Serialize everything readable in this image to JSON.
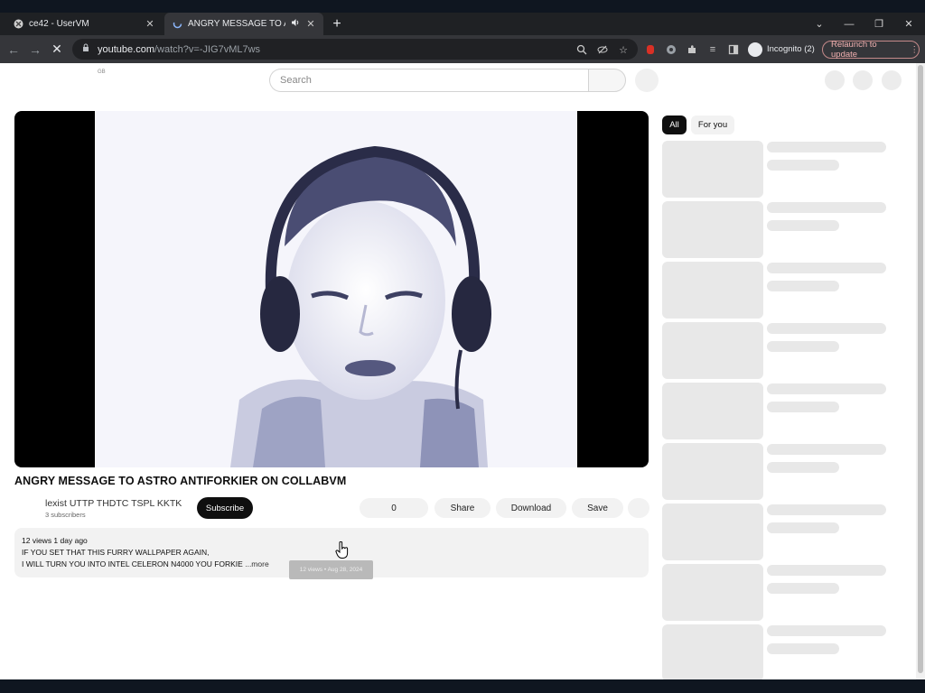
{
  "browser": {
    "tabs": [
      {
        "label": "ce42 - UserVM",
        "close": "✕"
      },
      {
        "label": "ANGRY MESSAGE TO ASTRO",
        "close": "✕"
      }
    ],
    "new_tab": "+",
    "url_host": "youtube.com",
    "url_path": "/watch?v=-JIG7vML7ws",
    "incognito_label": "Incognito (2)",
    "relaunch_label": "Relaunch to update"
  },
  "youtube": {
    "logo_suffix": "GB",
    "search_placeholder": "Search",
    "video_title": "ANGRY MESSAGE TO ASTRO ANTIFORKIER ON COLLABVM",
    "channel_name": "lexist UTTP THDTC TSPL KKTK",
    "channel_subs": "3 subscribers",
    "subscribe_label": "Subscribe",
    "like_count": "0",
    "share_label": "Share",
    "download_label": "Download",
    "save_label": "Save",
    "description": {
      "meta": "12 views  1 day ago",
      "line1": "IF YOU SET THAT THIS FURRY WALLPAPER AGAIN,",
      "line2": "I WILL TURN YOU INTO INTEL CELERON N4000 YOU FORKIE",
      "more": "...more"
    },
    "tooltip": "12 views • Aug 28, 2024",
    "chips": [
      "All",
      "For you"
    ]
  },
  "colors": {
    "chrome_dark": "#1f2124",
    "chrome_toolbar": "#35363a",
    "page_bg": "#ffffff",
    "skeleton": "#e8e8e8",
    "subscribe_bg": "#0f0f0f"
  }
}
